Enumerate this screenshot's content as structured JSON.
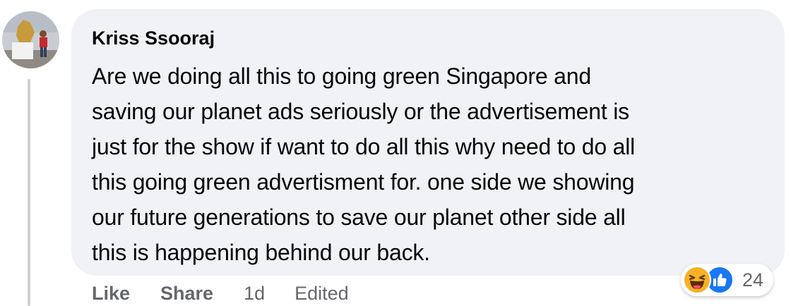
{
  "comment": {
    "author": "Kriss Ssooraj",
    "text_lines": [
      "Are we doing all this to going green Singapore and",
      "saving our planet ads seriously or the advertisement is",
      "just for the show if want to do all this why need to do all",
      "this going green advertisment for. one side we showing",
      "our future generations to save our planet other side all",
      "this is happening behind our back."
    ]
  },
  "actions": {
    "like_label": "Like",
    "share_label": "Share",
    "timestamp": "1d",
    "edited_label": "Edited"
  },
  "reactions": {
    "types": [
      "haha-icon",
      "like-icon"
    ],
    "count": "24"
  },
  "colors": {
    "bubble_bg": "#f0f2f5",
    "text": "#050505",
    "secondary_text": "#65676b",
    "haha": "#f7b125",
    "like": "#1877f2",
    "thread_line": "#ced0d4"
  }
}
